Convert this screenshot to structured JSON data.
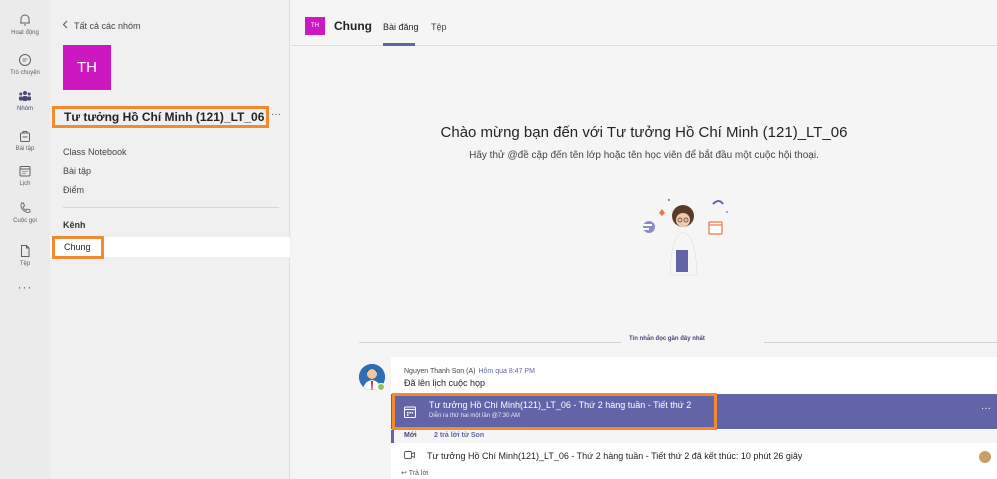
{
  "rail": {
    "items": [
      {
        "label": "Hoạt động",
        "icon": "bell-icon"
      },
      {
        "label": "Trò chuyện",
        "icon": "chat-icon"
      },
      {
        "label": "Nhóm",
        "icon": "teams-icon"
      },
      {
        "label": "Bài tập",
        "icon": "assignment-icon"
      },
      {
        "label": "Lịch",
        "icon": "calendar-icon"
      },
      {
        "label": "Cuộc gọi",
        "icon": "phone-icon"
      },
      {
        "label": "Tệp",
        "icon": "file-icon"
      }
    ],
    "more": "···"
  },
  "team": {
    "back_label": "Tất cả các nhóm",
    "avatar_initials": "TH",
    "name": "Tư tưởng Hồ Chí Minh (121)_LT_06",
    "more": "···",
    "links": [
      "Class Notebook",
      "Bài tập",
      "Điểm"
    ],
    "channels_heading": "Kênh",
    "channel_selected": "Chung"
  },
  "header": {
    "avatar_initials": "TH",
    "title": "Chung",
    "tabs": [
      "Bài đăng",
      "Tệp"
    ]
  },
  "welcome": {
    "title": "Chào mừng bạn đến với Tư tưởng Hồ Chí Minh (121)_LT_06",
    "hint": "Hãy thử @đề cập đến tên lớp hoặc tên học viên để bắt đầu một cuộc hội thoại."
  },
  "recent_divider": "Tin nhắn đọc gần đây nhất",
  "post": {
    "author": "Nguyen Thanh Son (A)",
    "time": "Hôm qua 8:47 PM",
    "message": "Đã lên lịch cuộc họp",
    "meeting_title": "Tư tưởng Hồ Chí Minh(121)_LT_06 - Thứ 2 hàng tuần - Tiết thứ 2",
    "meeting_sub": "Diễn ra thứ hai một lần @7:30 AM",
    "meeting_more": "···",
    "new_badge": "Mới",
    "replies_text": "2 trả lời từ Son",
    "ended_text": "Tư tưởng Hồ Chí Minh(121)_LT_06 - Thứ 2 hàng tuần - Tiết thứ 2 đã kết thúc: 10 phút 26 giây",
    "reply_label": "Trả lời"
  },
  "colors": {
    "accent": "#6264a7",
    "team_avatar": "#cc18c0",
    "highlight_box": "#f28a31",
    "presence": "#92c353"
  }
}
